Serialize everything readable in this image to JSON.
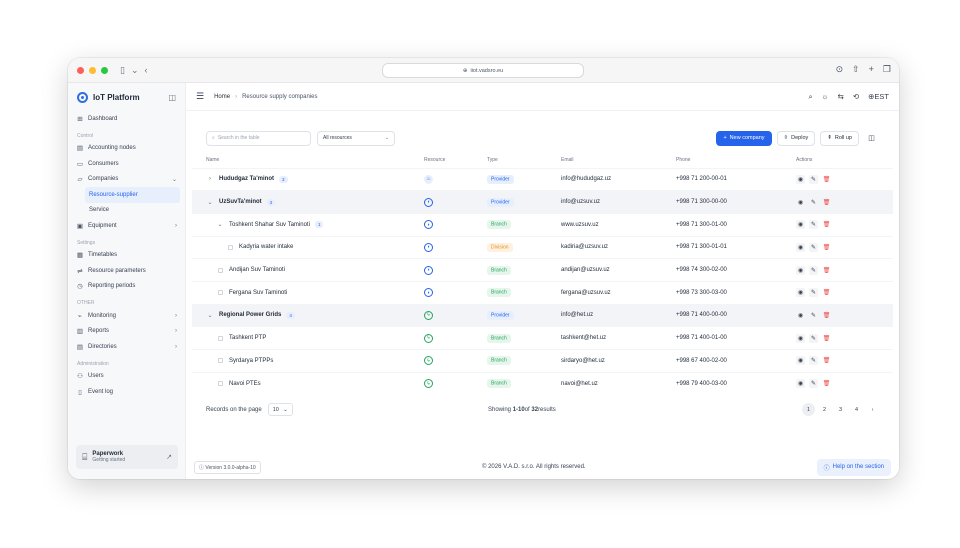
{
  "browser": {
    "url": "iiot.vadsro.eu"
  },
  "sidebar": {
    "brand": "IoT Platform",
    "dashboard": "Dashboard",
    "sections": {
      "control": "Control",
      "settings": "Settings",
      "other": "OTHER",
      "admin": "Administration"
    },
    "items": {
      "accounting_nodes": "Accounting nodes",
      "consumers": "Consumers",
      "companies": "Companies",
      "resource_supplier": "Resource-supplier",
      "service": "Service",
      "equipment": "Equipment",
      "timetables": "Timetables",
      "resource_parameters": "Resource parameters",
      "reporting_periods": "Reporting periods",
      "monitoring": "Monitoring",
      "reports": "Reports",
      "directories": "Directories",
      "users": "Users",
      "event_log": "Event log"
    },
    "paperwork": {
      "title": "Paperwork",
      "subtitle": "Getting started"
    }
  },
  "topbar": {
    "breadcrumb_home": "Home",
    "breadcrumb_current": "Resource supply companies",
    "language": "EST"
  },
  "filters": {
    "search_placeholder": "Search in the table",
    "resource_select": "All resources",
    "new_company": "New company",
    "deploy": "Deploy",
    "rollup": "Roll up"
  },
  "table": {
    "headers": {
      "name": "Name",
      "resource": "Resource",
      "type": "Type",
      "email": "Email",
      "phone": "Phone",
      "actions": "Actions"
    },
    "rows": [
      {
        "name": "Hududgaz Ta'minot",
        "count": "3",
        "type": "Provider",
        "email": "info@hududgaz.uz",
        "phone": "+998 71 200-00-01"
      },
      {
        "name": "UzSuvTa'minot",
        "count": "3",
        "type": "Provider",
        "email": "info@uzsuv.uz",
        "phone": "+998 71 300-00-00"
      },
      {
        "name": "Toshkent Shahar Suv Taminoti",
        "count": "1",
        "type": "Branch",
        "email": "www.uzsuv.uz",
        "phone": "+998 71 300-01-00"
      },
      {
        "name": "Kadyria water intake",
        "type": "Division",
        "email": "kadiria@uzsuv.uz",
        "phone": "+998 71 300-01-01"
      },
      {
        "name": "Andijan Suv Taminoti",
        "type": "Branch",
        "email": "andijan@uzsuv.uz",
        "phone": "+998 74 300-02-00"
      },
      {
        "name": "Fergana Suv Taminoti",
        "type": "Branch",
        "email": "fergana@uzsuv.uz",
        "phone": "+998 73 300-03-00"
      },
      {
        "name": "Regional Power Grids",
        "count": "4",
        "type": "Provider",
        "email": "info@het.uz",
        "phone": "+998 71 400-00-00"
      },
      {
        "name": "Tashkent PTP",
        "type": "Branch",
        "email": "tashkent@het.uz",
        "phone": "+998 71 400-01-00"
      },
      {
        "name": "Syrdarya PTPPs",
        "type": "Branch",
        "email": "sirdaryo@het.uz",
        "phone": "+998 67 400-02-00"
      },
      {
        "name": "Navoi PTEs",
        "type": "Branch",
        "email": "navoi@het.uz",
        "phone": "+998 79 400-03-00"
      }
    ]
  },
  "pagination": {
    "records_label": "Records on the page",
    "per_page": "10",
    "showing_prefix": "Showing ",
    "showing_range": "1-10",
    "showing_of": "of ",
    "showing_total": "32",
    "showing_suffix": "results",
    "pages": [
      "1",
      "2",
      "3",
      "4"
    ]
  },
  "footer": {
    "version": "Version 3.0.0-alpha-10",
    "copyright": "© 2026 V.A.D. s.r.o. All rights reserved.",
    "help": "Help on the section"
  },
  "colors": {
    "accent": "#2563eb",
    "provider": "#2563eb",
    "branch": "#22a55a",
    "division": "#f08c1a",
    "delete": "#ef4444"
  }
}
